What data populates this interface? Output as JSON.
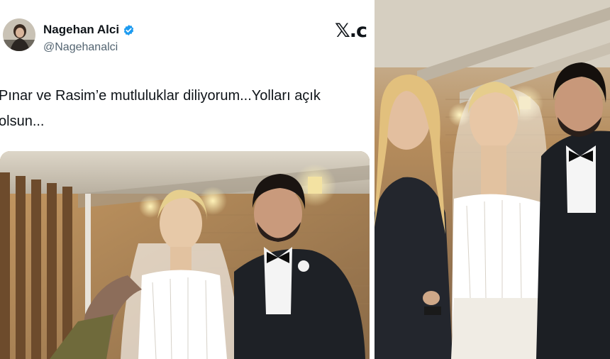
{
  "tweet": {
    "author_name": "Nagehan Alci",
    "handle": "@Nagehanalci",
    "verified_icon": "verified-badge-icon",
    "platform_logo_text": "𝕏.c",
    "text": "Pınar ve Rasim’e mutluluklar diliyorum...Yolları açık olsun..."
  },
  "colors": {
    "verified_blue": "#1d9bf0",
    "text_primary": "#0f1419",
    "text_secondary": "#536471"
  }
}
